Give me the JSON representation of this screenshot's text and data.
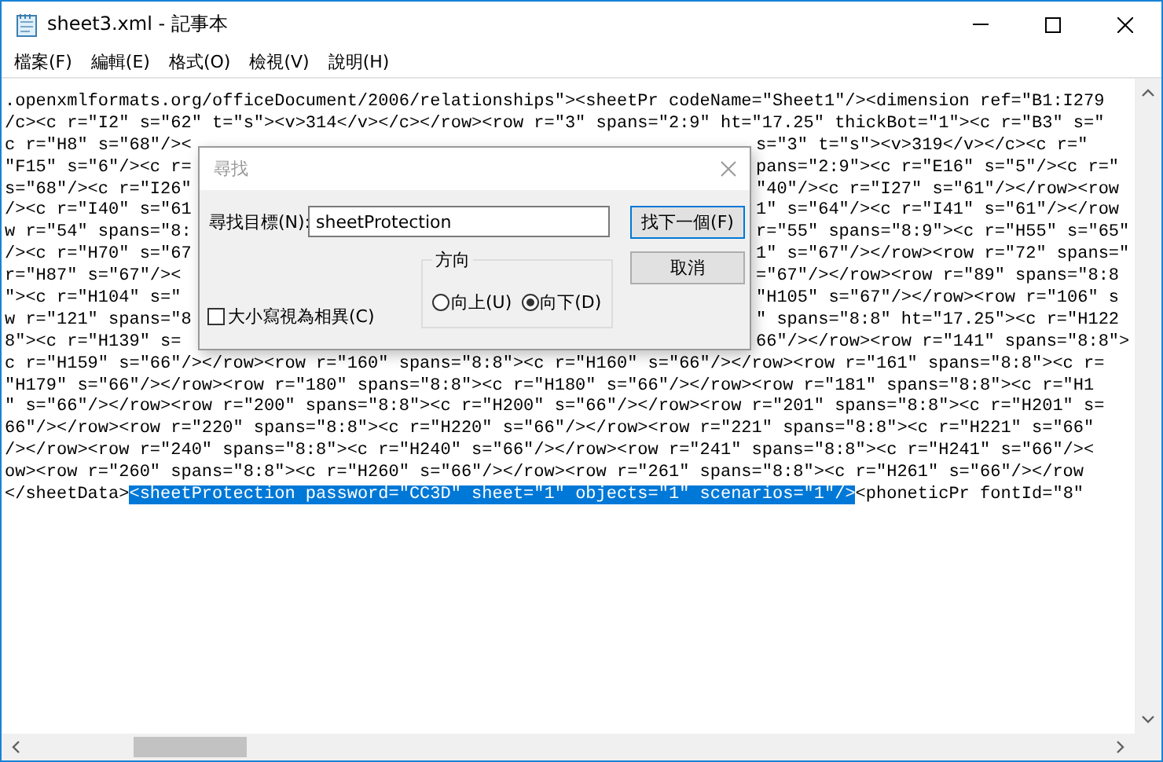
{
  "window": {
    "title": "sheet3.xml - 記事本"
  },
  "menu": [
    "檔案(F)",
    "編輯(E)",
    "格式(O)",
    "檢視(V)",
    "說明(H)"
  ],
  "lines": [
    {
      "kind": "full",
      "segments": [
        {
          "text": ".openxmlformats.org/officeDocument/2006/relationships\"><sheetPr codeName=\"Sheet1\"/><dimension ref=\"B1:I279",
          "selected": false
        }
      ]
    },
    {
      "kind": "full",
      "segments": [
        {
          "text": "/c><c r=\"I2\" s=\"62\" t=\"s\"><v>314</v></c></row><row r=\"3\" spans=\"2:9\" ht=\"17.25\" thickBot=\"1\"><c r=\"B3\" s=\"",
          "selected": false
        }
      ]
    },
    {
      "kind": "split",
      "left": "c r=\"H8\" s=\"68\"/><",
      "right": "s=\"3\" t=\"s\"><v>319</v></c><c r=\""
    },
    {
      "kind": "split",
      "left": "\"F15\" s=\"6\"/><c r=",
      "right": "pans=\"2:9\"><c r=\"E16\" s=\"5\"/><c r=\""
    },
    {
      "kind": "split",
      "left": "s=\"68\"/><c r=\"I26\"",
      "right": "\"40\"/><c r=\"I27\" s=\"61\"/></row><row"
    },
    {
      "kind": "split",
      "left": "/><c r=\"I40\" s=\"61",
      "right": "1\" s=\"64\"/><c r=\"I41\" s=\"61\"/></row"
    },
    {
      "kind": "split",
      "left": "w r=\"54\" spans=\"8:",
      "right": "r=\"55\" spans=\"8:9\"><c r=\"H55\" s=\"65\""
    },
    {
      "kind": "split",
      "left": "/><c r=\"H70\" s=\"67",
      "right": "1\" s=\"67\"/></row><row r=\"72\" spans=\""
    },
    {
      "kind": "split",
      "left": "r=\"H87\" s=\"67\"/><",
      "right": "=\"67\"/></row><row r=\"89\" spans=\"8:8"
    },
    {
      "kind": "split",
      "left": "\"><c r=\"H104\" s=\"",
      "right": "\"H105\" s=\"67\"/></row><row r=\"106\" s"
    },
    {
      "kind": "split",
      "left": "w r=\"121\" spans=\"8",
      "right": "\" spans=\"8:8\" ht=\"17.25\"><c r=\"H122"
    },
    {
      "kind": "split",
      "left": "8\"><c r=\"H139\" s=",
      "right": "66\"/></row><row r=\"141\" spans=\"8:8\">"
    },
    {
      "kind": "full",
      "segments": [
        {
          "text": "c r=\"H159\" s=\"66\"/></row><row r=\"160\" spans=\"8:8\"><c r=\"H160\" s=\"66\"/></row><row r=\"161\" spans=\"8:8\"><c r=",
          "selected": false
        }
      ]
    },
    {
      "kind": "full",
      "segments": [
        {
          "text": "\"H179\" s=\"66\"/></row><row r=\"180\" spans=\"8:8\"><c r=\"H180\" s=\"66\"/></row><row r=\"181\" spans=\"8:8\"><c r=\"H1",
          "selected": false
        }
      ]
    },
    {
      "kind": "full",
      "segments": [
        {
          "text": "\" s=\"66\"/></row><row r=\"200\" spans=\"8:8\"><c r=\"H200\" s=\"66\"/></row><row r=\"201\" spans=\"8:8\"><c r=\"H201\" s=",
          "selected": false
        }
      ]
    },
    {
      "kind": "full",
      "segments": [
        {
          "text": "66\"/></row><row r=\"220\" spans=\"8:8\"><c r=\"H220\" s=\"66\"/></row><row r=\"221\" spans=\"8:8\"><c r=\"H221\" s=\"66\"",
          "selected": false
        }
      ]
    },
    {
      "kind": "full",
      "segments": [
        {
          "text": "/></row><row r=\"240\" spans=\"8:8\"><c r=\"H240\" s=\"66\"/></row><row r=\"241\" spans=\"8:8\"><c r=\"H241\" s=\"66\"/><",
          "selected": false
        }
      ]
    },
    {
      "kind": "full",
      "segments": [
        {
          "text": "ow><row r=\"260\" spans=\"8:8\"><c r=\"H260\" s=\"66\"/></row><row r=\"261\" spans=\"8:8\"><c r=\"H261\" s=\"66\"/></row",
          "selected": false
        }
      ]
    },
    {
      "kind": "full",
      "segments": [
        {
          "text": "</sheetData>",
          "selected": false
        },
        {
          "text": "<sheetProtection password=\"CC3D\" sheet=\"1\" objects=\"1\" scenarios=\"1\"/>",
          "selected": true
        },
        {
          "text": "<phoneticPr fontId=\"8\"",
          "selected": false
        }
      ]
    }
  ],
  "dialog": {
    "title": "尋找",
    "find_label": "尋找目標(N):",
    "find_value": "sheetProtection",
    "find_next_button": "找下一個(F)",
    "cancel_button": "取消",
    "direction": {
      "label": "方向",
      "options": [
        {
          "label": "向上(U)",
          "selected": false
        },
        {
          "label": "向下(D)",
          "selected": true
        }
      ]
    },
    "match_case": {
      "label": "大小寫視為相異(C)",
      "checked": false
    }
  }
}
